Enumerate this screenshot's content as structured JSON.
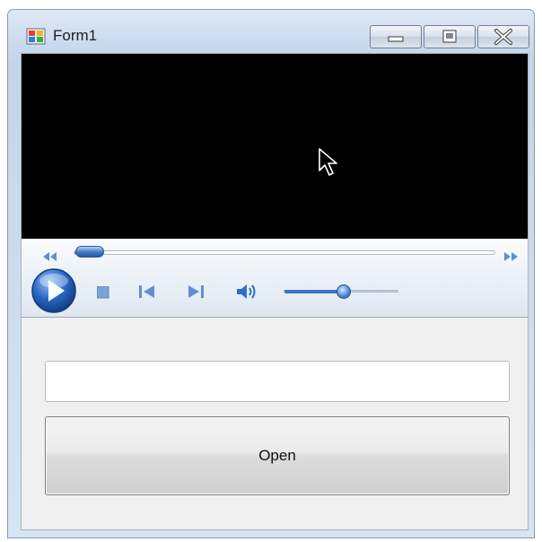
{
  "window": {
    "title": "Form1",
    "icons": {
      "app": "windows-form-icon",
      "minimize": "minimize-icon",
      "maximize": "maximize-icon",
      "close": "close-icon"
    }
  },
  "player": {
    "seek_progress": 0.02,
    "volume_level": 0.5,
    "icons": {
      "play": "play-icon",
      "stop": "stop-icon",
      "previous": "previous-icon",
      "next": "next-icon",
      "volume": "speaker-icon",
      "rewind": "rewind-icon",
      "fast_forward": "fast-forward-icon",
      "cursor": "mouse-pointer-icon"
    }
  },
  "form": {
    "path_input_value": "",
    "open_button_label": "Open"
  },
  "colors": {
    "accent": "#3e74c1",
    "video_background": "#000000"
  }
}
